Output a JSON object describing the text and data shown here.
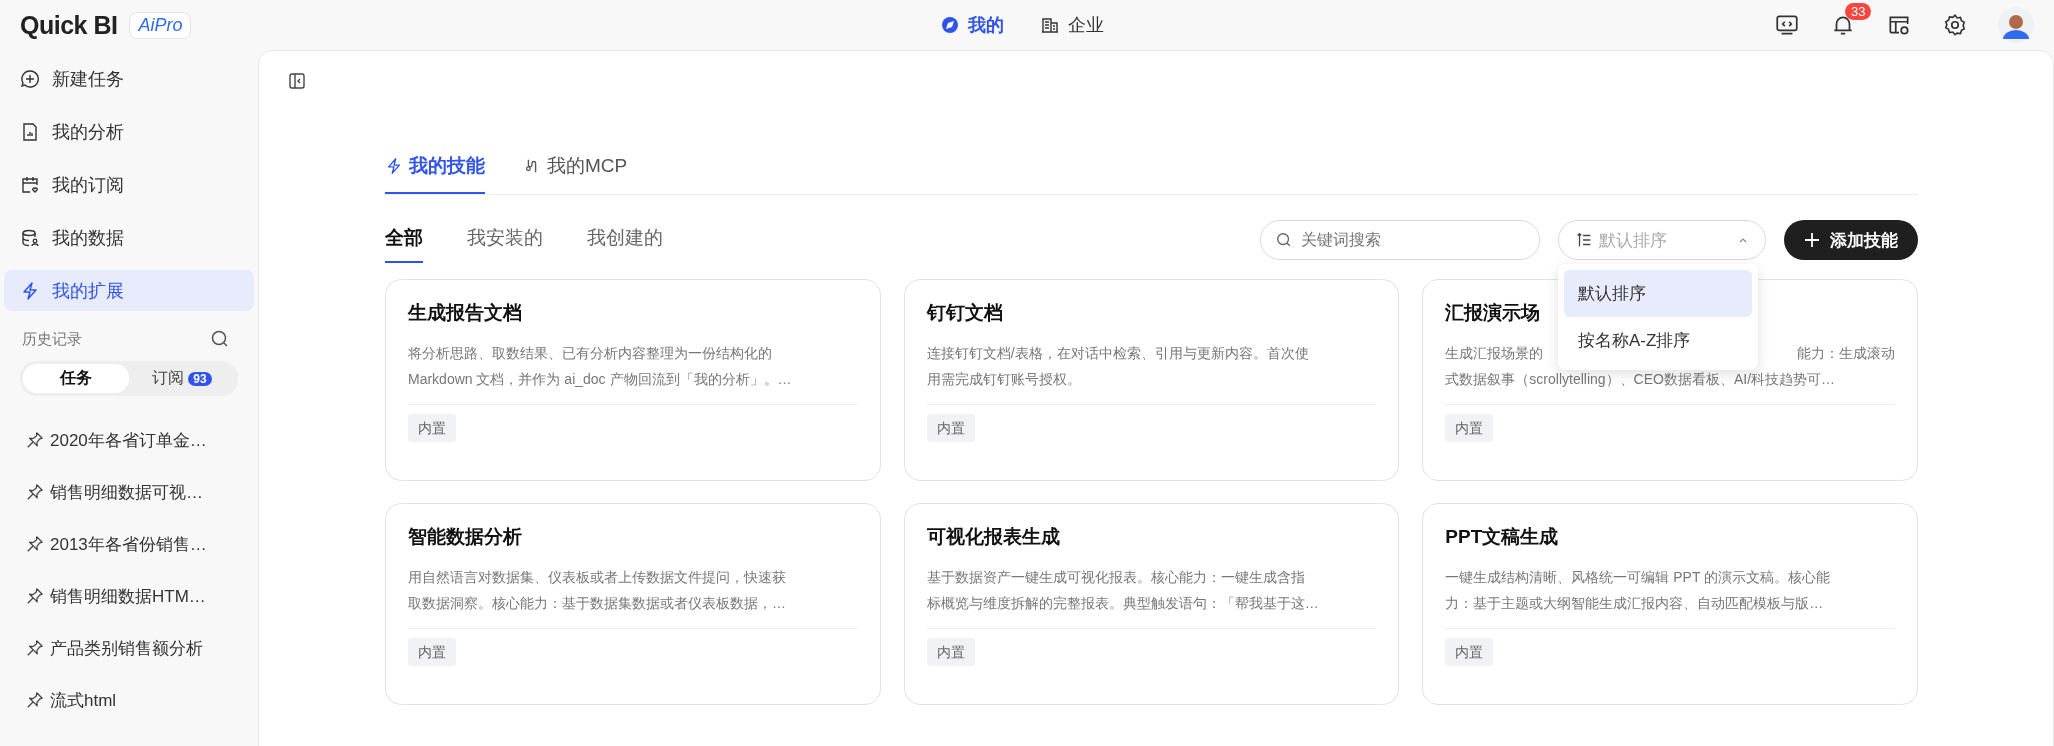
{
  "brand": {
    "logo": "Quick BI",
    "badge": "AiPro"
  },
  "top_nav": [
    {
      "label": "我的",
      "selected": true
    },
    {
      "label": "企业",
      "selected": false
    }
  ],
  "top_actions": {
    "notifications": "33"
  },
  "sidebar": {
    "items": [
      {
        "label": "新建任务",
        "selected": false
      },
      {
        "label": "我的分析",
        "selected": false
      },
      {
        "label": "我的订阅",
        "selected": false
      },
      {
        "label": "我的数据",
        "selected": false
      },
      {
        "label": "我的扩展",
        "selected": true
      }
    ],
    "history_title": "历史记录",
    "toggle": [
      {
        "label": "任务",
        "selected": true
      },
      {
        "label": "订阅",
        "count": "93",
        "selected": false
      }
    ],
    "history": [
      "2020年各省订单金…",
      "销售明细数据可视…",
      "2013年各省份销售…",
      "销售明细数据HTM…",
      "产品类别销售额分析",
      "流式html"
    ]
  },
  "tabs": [
    {
      "label": "我的技能",
      "selected": true
    },
    {
      "label": "我的MCP",
      "selected": false
    }
  ],
  "filters": [
    {
      "label": "全部",
      "selected": true
    },
    {
      "label": "我安装的",
      "selected": false
    },
    {
      "label": "我创建的",
      "selected": false
    }
  ],
  "search": {
    "placeholder": "关键词搜索"
  },
  "sort": {
    "placeholder": "默认排序",
    "expanded": true,
    "options": [
      {
        "label": "默认排序",
        "selected": true
      },
      {
        "label": "按名称A-Z排序",
        "selected": false
      }
    ]
  },
  "add_button": "添加技能",
  "cards": [
    {
      "title": "生成报告文档",
      "lines": [
        [
          "将分析思路、取数结果、已有分析内容整理为一份结构化的"
        ],
        [
          "Markdown 文档，并作为 ai_doc 产物回流到「我的分析」。…"
        ]
      ],
      "tag": "内置"
    },
    {
      "title": "钉钉文档",
      "lines": [
        [
          "连接钉钉文档/表格，在对话中检索、引用与更新内容。首次使"
        ],
        [
          "用需完成钉钉账号授权。"
        ]
      ],
      "tag": "内置"
    },
    {
      "title": "汇报演示场",
      "lines": [
        [
          "生成汇报场景的",
          "能力：生成滚动"
        ],
        [
          "式数据叙事（scrollytelling）、CEO数据看板、AI/科技趋势可…"
        ]
      ],
      "tag": "内置"
    },
    {
      "title": "智能数据分析",
      "lines": [
        [
          "用自然语言对数据集、仪表板或者上传数据文件提问，快速获"
        ],
        [
          "取数据洞察。核心能力：基于数据集数据或者仪表板数据，…"
        ]
      ],
      "tag": "内置"
    },
    {
      "title": "可视化报表生成",
      "lines": [
        [
          "基于数据资产一键生成可视化报表。核心能力：一键生成含指"
        ],
        [
          "标概览与维度拆解的完整报表。典型触发语句：「帮我基于这…"
        ]
      ],
      "tag": "内置"
    },
    {
      "title": "PPT文稿生成",
      "lines": [
        [
          "一键生成结构清晰、风格统一可编辑 PPT 的演示文稿。核心能"
        ],
        [
          "力：基于主题或大纲智能生成汇报内容、自动匹配模板与版…"
        ]
      ],
      "tag": "内置"
    }
  ]
}
